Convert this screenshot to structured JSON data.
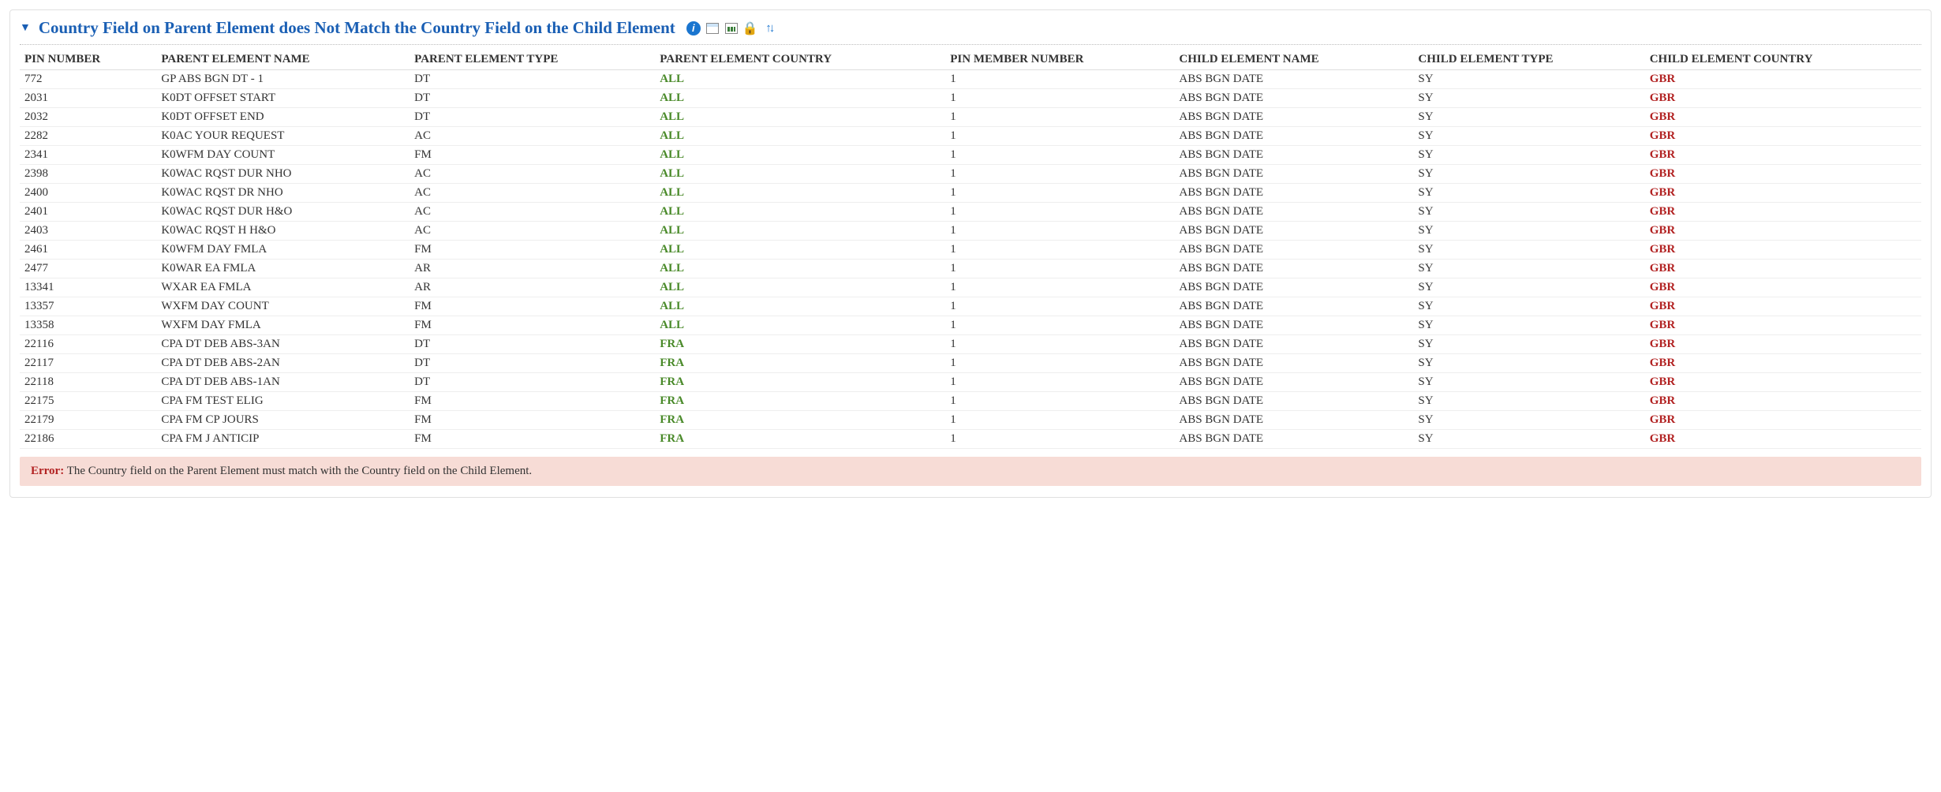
{
  "panel": {
    "title": "Country Field on Parent Element does Not Match the Country Field on the Child Element"
  },
  "table": {
    "columns": [
      "PIN NUMBER",
      "PARENT ELEMENT NAME",
      "PARENT ELEMENT TYPE",
      "PARENT ELEMENT COUNTRY",
      "PIN MEMBER NUMBER",
      "CHILD ELEMENT NAME",
      "CHILD ELEMENT TYPE",
      "CHILD ELEMENT COUNTRY"
    ],
    "rows": [
      {
        "pin": "772",
        "pname": "GP ABS BGN DT - 1",
        "ptype": "DT",
        "pcountry": "ALL",
        "member": "1",
        "cname": "ABS BGN DATE",
        "ctype": "SY",
        "ccountry": "GBR"
      },
      {
        "pin": "2031",
        "pname": "K0DT OFFSET START",
        "ptype": "DT",
        "pcountry": "ALL",
        "member": "1",
        "cname": "ABS BGN DATE",
        "ctype": "SY",
        "ccountry": "GBR"
      },
      {
        "pin": "2032",
        "pname": "K0DT OFFSET END",
        "ptype": "DT",
        "pcountry": "ALL",
        "member": "1",
        "cname": "ABS BGN DATE",
        "ctype": "SY",
        "ccountry": "GBR"
      },
      {
        "pin": "2282",
        "pname": "K0AC YOUR REQUEST",
        "ptype": "AC",
        "pcountry": "ALL",
        "member": "1",
        "cname": "ABS BGN DATE",
        "ctype": "SY",
        "ccountry": "GBR"
      },
      {
        "pin": "2341",
        "pname": "K0WFM DAY COUNT",
        "ptype": "FM",
        "pcountry": "ALL",
        "member": "1",
        "cname": "ABS BGN DATE",
        "ctype": "SY",
        "ccountry": "GBR"
      },
      {
        "pin": "2398",
        "pname": "K0WAC RQST DUR NHO",
        "ptype": "AC",
        "pcountry": "ALL",
        "member": "1",
        "cname": "ABS BGN DATE",
        "ctype": "SY",
        "ccountry": "GBR"
      },
      {
        "pin": "2400",
        "pname": "K0WAC RQST DR NHO",
        "ptype": "AC",
        "pcountry": "ALL",
        "member": "1",
        "cname": "ABS BGN DATE",
        "ctype": "SY",
        "ccountry": "GBR"
      },
      {
        "pin": "2401",
        "pname": "K0WAC RQST DUR H&O",
        "ptype": "AC",
        "pcountry": "ALL",
        "member": "1",
        "cname": "ABS BGN DATE",
        "ctype": "SY",
        "ccountry": "GBR"
      },
      {
        "pin": "2403",
        "pname": "K0WAC RQST H H&O",
        "ptype": "AC",
        "pcountry": "ALL",
        "member": "1",
        "cname": "ABS BGN DATE",
        "ctype": "SY",
        "ccountry": "GBR"
      },
      {
        "pin": "2461",
        "pname": "K0WFM DAY FMLA",
        "ptype": "FM",
        "pcountry": "ALL",
        "member": "1",
        "cname": "ABS BGN DATE",
        "ctype": "SY",
        "ccountry": "GBR"
      },
      {
        "pin": "2477",
        "pname": "K0WAR EA FMLA",
        "ptype": "AR",
        "pcountry": "ALL",
        "member": "1",
        "cname": "ABS BGN DATE",
        "ctype": "SY",
        "ccountry": "GBR"
      },
      {
        "pin": "13341",
        "pname": "WXAR EA FMLA",
        "ptype": "AR",
        "pcountry": "ALL",
        "member": "1",
        "cname": "ABS BGN DATE",
        "ctype": "SY",
        "ccountry": "GBR"
      },
      {
        "pin": "13357",
        "pname": "WXFM DAY COUNT",
        "ptype": "FM",
        "pcountry": "ALL",
        "member": "1",
        "cname": "ABS BGN DATE",
        "ctype": "SY",
        "ccountry": "GBR"
      },
      {
        "pin": "13358",
        "pname": "WXFM DAY FMLA",
        "ptype": "FM",
        "pcountry": "ALL",
        "member": "1",
        "cname": "ABS BGN DATE",
        "ctype": "SY",
        "ccountry": "GBR"
      },
      {
        "pin": "22116",
        "pname": "CPA DT DEB ABS-3AN",
        "ptype": "DT",
        "pcountry": "FRA",
        "member": "1",
        "cname": "ABS BGN DATE",
        "ctype": "SY",
        "ccountry": "GBR"
      },
      {
        "pin": "22117",
        "pname": "CPA DT DEB ABS-2AN",
        "ptype": "DT",
        "pcountry": "FRA",
        "member": "1",
        "cname": "ABS BGN DATE",
        "ctype": "SY",
        "ccountry": "GBR"
      },
      {
        "pin": "22118",
        "pname": "CPA DT DEB ABS-1AN",
        "ptype": "DT",
        "pcountry": "FRA",
        "member": "1",
        "cname": "ABS BGN DATE",
        "ctype": "SY",
        "ccountry": "GBR"
      },
      {
        "pin": "22175",
        "pname": "CPA FM TEST ELIG",
        "ptype": "FM",
        "pcountry": "FRA",
        "member": "1",
        "cname": "ABS BGN DATE",
        "ctype": "SY",
        "ccountry": "GBR"
      },
      {
        "pin": "22179",
        "pname": "CPA FM CP JOURS",
        "ptype": "FM",
        "pcountry": "FRA",
        "member": "1",
        "cname": "ABS BGN DATE",
        "ctype": "SY",
        "ccountry": "GBR"
      },
      {
        "pin": "22186",
        "pname": "CPA FM J ANTICIP",
        "ptype": "FM",
        "pcountry": "FRA",
        "member": "1",
        "cname": "ABS BGN DATE",
        "ctype": "SY",
        "ccountry": "GBR"
      }
    ]
  },
  "error": {
    "label": "Error:",
    "message": "The Country field on the Parent Element must match with the Country field on the Child Element."
  }
}
